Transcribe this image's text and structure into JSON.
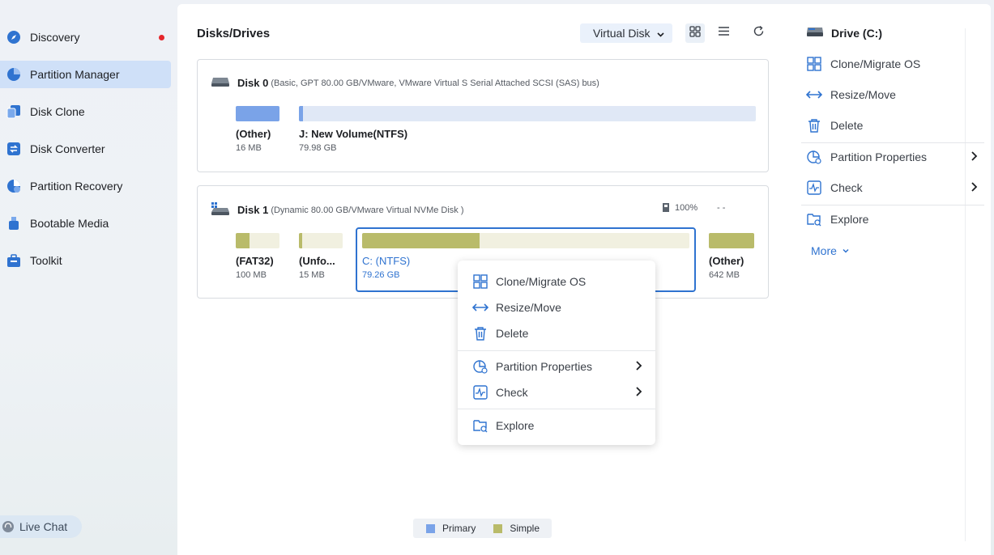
{
  "sidebar": {
    "items": [
      {
        "label": "Discovery",
        "icon": "compass-icon"
      },
      {
        "label": "Partition Manager",
        "icon": "pie-chart-icon"
      },
      {
        "label": "Disk Clone",
        "icon": "clone-icon"
      },
      {
        "label": "Disk Converter",
        "icon": "converter-icon"
      },
      {
        "label": "Partition Recovery",
        "icon": "recovery-icon"
      },
      {
        "label": "Bootable Media",
        "icon": "usb-icon"
      },
      {
        "label": "Toolkit",
        "icon": "toolkit-icon"
      }
    ],
    "live_chat": "Live Chat"
  },
  "header": {
    "title": "Disks/Drives",
    "view_select": "Virtual Disk"
  },
  "disks": [
    {
      "name": "Disk 0",
      "info": "(Basic, GPT 80.00 GB/VMware,  VMware Virtual S Serial Attached SCSI (SAS) bus)",
      "partitions": [
        {
          "label": "(Other)",
          "size": "16 MB",
          "used_fraction": 1.0
        },
        {
          "label": "J: New Volume(NTFS)",
          "size": "79.98 GB",
          "used_fraction": 0.008
        }
      ]
    },
    {
      "name": "Disk 1",
      "info": "(Dynamic 80.00 GB/VMware Virtual NVMe Disk )",
      "health": "100%",
      "temperature": "- -",
      "partitions": [
        {
          "label": "(FAT32)",
          "size": "100 MB",
          "used_fraction": 0.32
        },
        {
          "label": "(Unfo...",
          "size": "15 MB",
          "used_fraction": 0.08
        },
        {
          "label": "C: (NTFS)",
          "size": "79.26 GB",
          "used_fraction": 0.36
        },
        {
          "label": "(Other)",
          "size": "642 MB",
          "used_fraction": 1.0
        }
      ]
    }
  ],
  "legend": {
    "primary": "Primary",
    "simple": "Simple"
  },
  "colors": {
    "primary": "#7aa3e8",
    "simple": "#b9bb6a",
    "primary_empty": "#e0e8f6",
    "simple_empty": "#f1f0e0",
    "accent": "#2f73d0"
  },
  "right_panel": {
    "title": "Drive (C:)",
    "items": {
      "clone": "Clone/Migrate OS",
      "resize": "Resize/Move",
      "delete": "Delete",
      "properties": "Partition Properties",
      "check": "Check",
      "explore": "Explore"
    },
    "more": "More"
  },
  "context_menu": {
    "clone": "Clone/Migrate OS",
    "resize": "Resize/Move",
    "delete": "Delete",
    "properties": "Partition Properties",
    "check": "Check",
    "explore": "Explore"
  }
}
